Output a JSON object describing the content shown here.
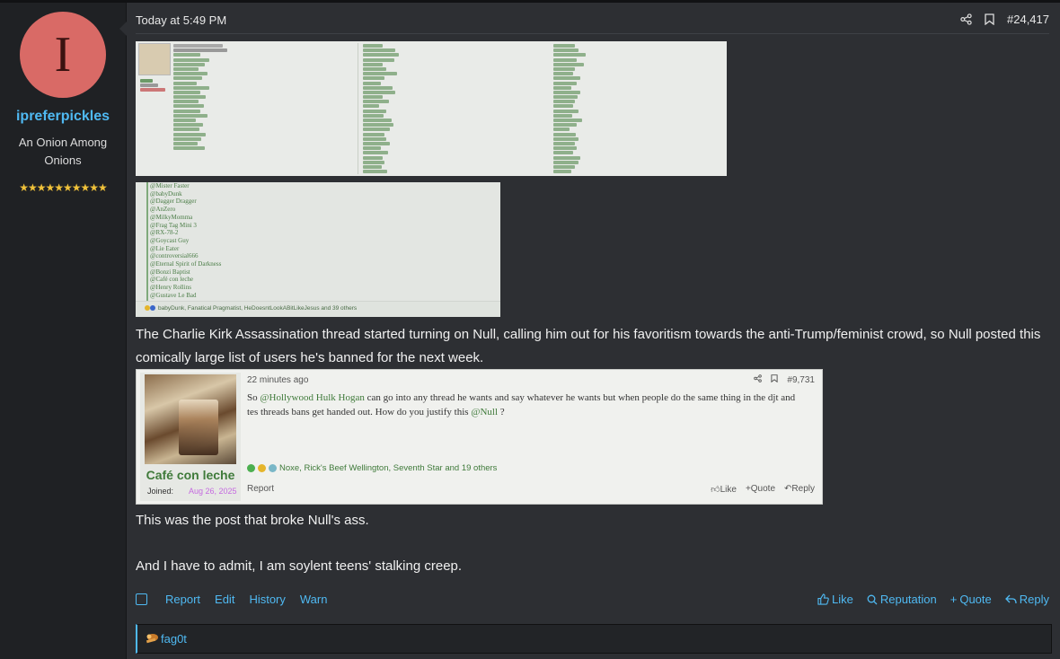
{
  "user": {
    "avatar_letter": "I",
    "avatar_color": "#d96a66",
    "username": "ipreferpickles",
    "title": "An Onion Among Onions",
    "stars": "★★★★★★★★★★"
  },
  "post": {
    "time": "Today at 5:49 PM",
    "number": "#24,417",
    "share_icon": "share-icon",
    "bookmark_icon": "bookmark-icon",
    "image2_names": [
      "@Mister Faster",
      "@babyDunk",
      "@Dagger Dragger",
      "@AnZero",
      "@MilkyMomma",
      "@Frag Tag Mini 3",
      "@RX-78-2",
      "@Goycast Guy",
      "@Lie Eater",
      "@controversial666",
      "@Eternal Spirit of Darkness",
      "@Bonzi Baptist",
      "@Café con leche",
      "@Henry Rollins",
      "@Gustave Le Bad"
    ],
    "image2_reactions": "babyDunk, Fanatical Pragmatist, HeDoesntLookABitLikeJesus and 39 others",
    "paragraph1": "The Charlie Kirk Assassination thread started turning on Null, calling him out for his favoritism towards the anti-Trump/feminist crowd, so Null posted this comically large list of users he's banned for the next week.",
    "paragraph2": "This was the post that broke Null's ass.",
    "paragraph3": "And I have to admit, I am soylent teens' stalking creep."
  },
  "quoted": {
    "username": "Café con leche",
    "joined_label": "Joined:",
    "joined_date": "Aug 26, 2025",
    "time": "22 minutes ago",
    "number": "#9,731",
    "msg_pre": "So ",
    "mention1": "@Hollywood Hulk Hogan",
    "msg_mid": " can go into any thread he wants and say whatever he wants but when people do the same thing in the djt and tes threads bans get handed out. How do you justify this ",
    "mention2": "@Null",
    "msg_post": " ?",
    "reactions": "Noxe, Rick's Beef Wellington, Seventh Star and 19 others",
    "report": "Report",
    "like": "Like",
    "quote": "Quote",
    "reply": "Reply"
  },
  "footer": {
    "report": "Report",
    "edit": "Edit",
    "history": "History",
    "warn": "Warn",
    "like": "Like",
    "reputation": "Reputation",
    "quote": "Quote",
    "reply": "Reply"
  },
  "reactors": {
    "name": "fag0t"
  }
}
